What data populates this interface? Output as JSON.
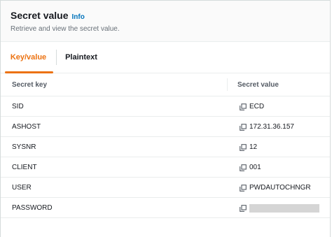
{
  "header": {
    "title": "Secret value",
    "info_label": "Info",
    "subtitle": "Retrieve and view the secret value."
  },
  "tabs": [
    {
      "label": "Key/value",
      "active": true
    },
    {
      "label": "Plaintext",
      "active": false
    }
  ],
  "table": {
    "columns": [
      "Secret key",
      "Secret value"
    ],
    "rows": [
      {
        "key": "SID",
        "value": "ECD"
      },
      {
        "key": "ASHOST",
        "value": "172.31.36.157"
      },
      {
        "key": "SYSNR",
        "value": "12"
      },
      {
        "key": "CLIENT",
        "value": "001"
      },
      {
        "key": "USER",
        "value": "PWDAUTOCHNGR"
      },
      {
        "key": "PASSWORD",
        "value": ""
      }
    ]
  },
  "icons": {
    "copy": "copy-icon"
  },
  "colors": {
    "accent": "#ec7211",
    "link": "#0073bb",
    "masked_value": "#d5d5d5"
  }
}
